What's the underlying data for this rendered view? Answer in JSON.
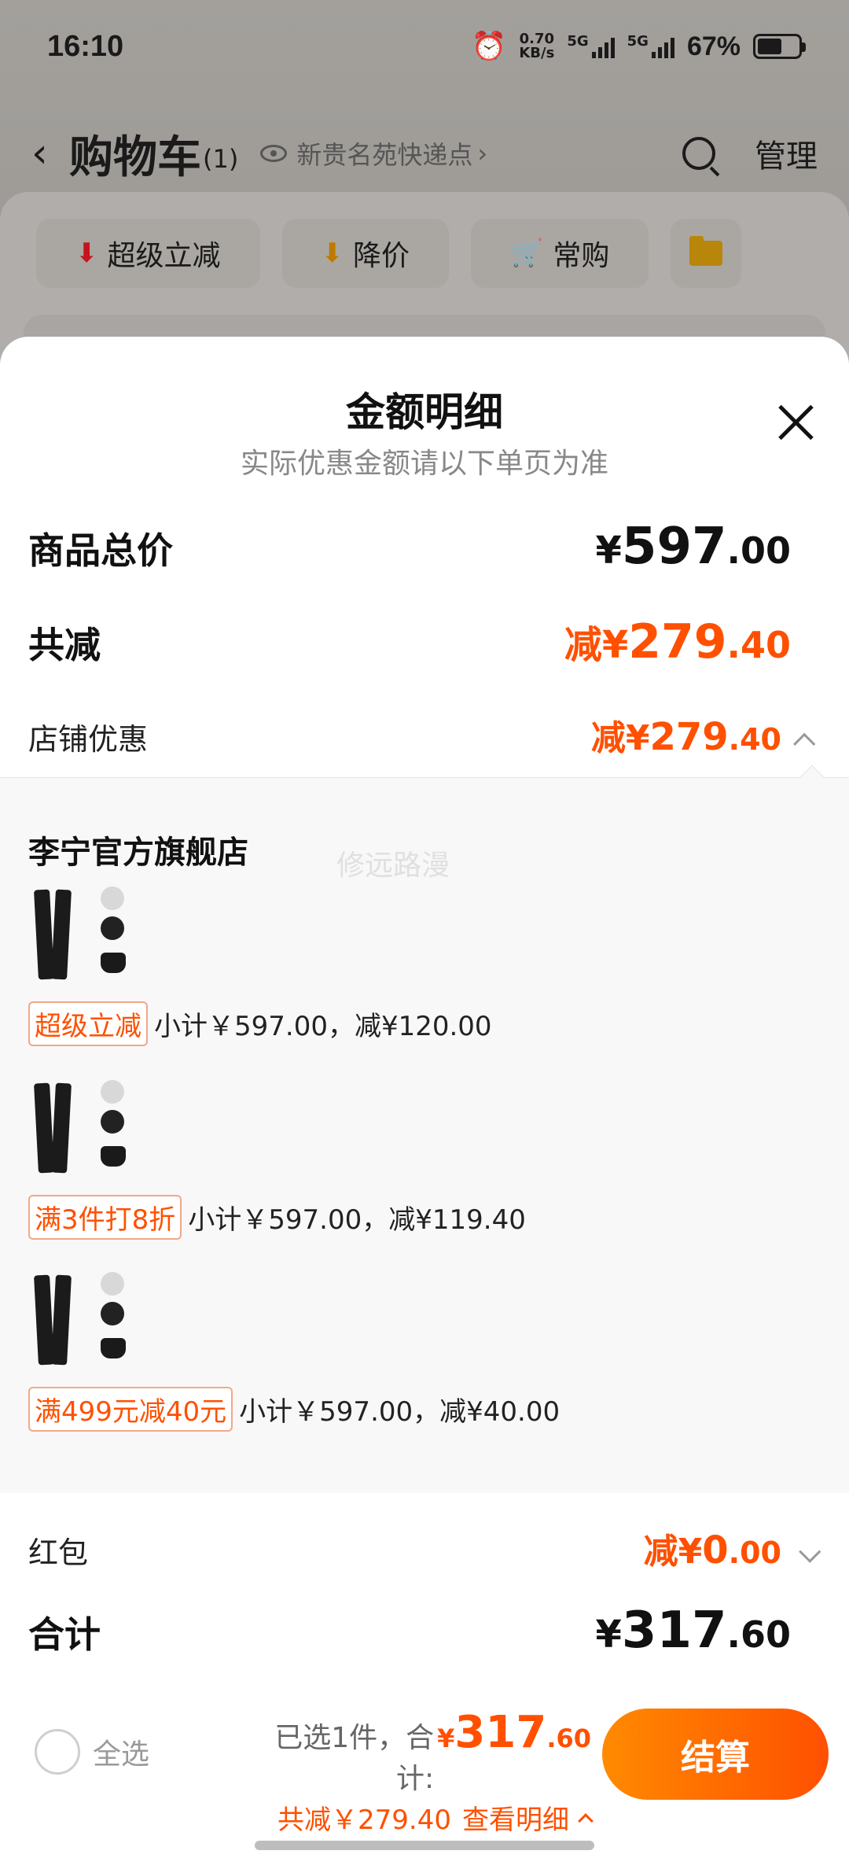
{
  "status": {
    "time": "16:10",
    "net_speed": "0.70",
    "net_unit": "KB/s",
    "sim1": "5G",
    "sim2": "5G",
    "battery": "67%"
  },
  "header": {
    "back_icon": "chevron-left-icon",
    "title": "购物车",
    "count": "(1)",
    "address": "新贵名苑快递点",
    "address_chevron": "›",
    "manage": "管理"
  },
  "filters": [
    {
      "label": "超级立减",
      "icon": "down-arrow-icon",
      "color": "#e0202b"
    },
    {
      "label": "降价",
      "icon": "down-arrow-icon",
      "color": "#d98a00"
    },
    {
      "label": "常购",
      "icon": "cart-icon",
      "color": "#d98a00"
    }
  ],
  "sheet": {
    "title": "金额明细",
    "subtitle": "实际优惠金额请以下单页为准",
    "total_label": "商品总价",
    "total": {
      "yen": "¥",
      "int": "597",
      "dec": ".00"
    },
    "discount_label": "共减",
    "discount": {
      "prefix": "减",
      "yen": "¥",
      "int": "279",
      "dec": ".40"
    },
    "store_discount_label": "店铺优惠",
    "store_discount": {
      "prefix": "减",
      "yen": "¥",
      "int": "279",
      "dec": ".40"
    },
    "store_name": "李宁官方旗舰店",
    "watermark": "修远路漫",
    "items": [
      {
        "tag": "超级立减",
        "text": "小计￥597.00，减¥120.00"
      },
      {
        "tag": "满3件打8折",
        "text": "小计￥597.00，减¥119.40"
      },
      {
        "tag": "满499元减40元",
        "text": "小计￥597.00，减¥40.00"
      }
    ],
    "redpacket_label": "红包",
    "redpacket": {
      "prefix": "减",
      "yen": "¥",
      "int": "0",
      "dec": ".00"
    },
    "sum_label": "合计",
    "sum": {
      "yen": "¥",
      "int": "317",
      "dec": ".60"
    }
  },
  "bottom": {
    "select_all": "全选",
    "selected_text": "已选1件，合计:",
    "total": {
      "yen": "¥",
      "int": "317",
      "dec": ".60"
    },
    "saved_text": "共减￥279.40",
    "view_detail": "查看明细",
    "checkout": "结算"
  },
  "colors": {
    "accent": "#ff5000",
    "checkout_start": "#ff8a00"
  }
}
